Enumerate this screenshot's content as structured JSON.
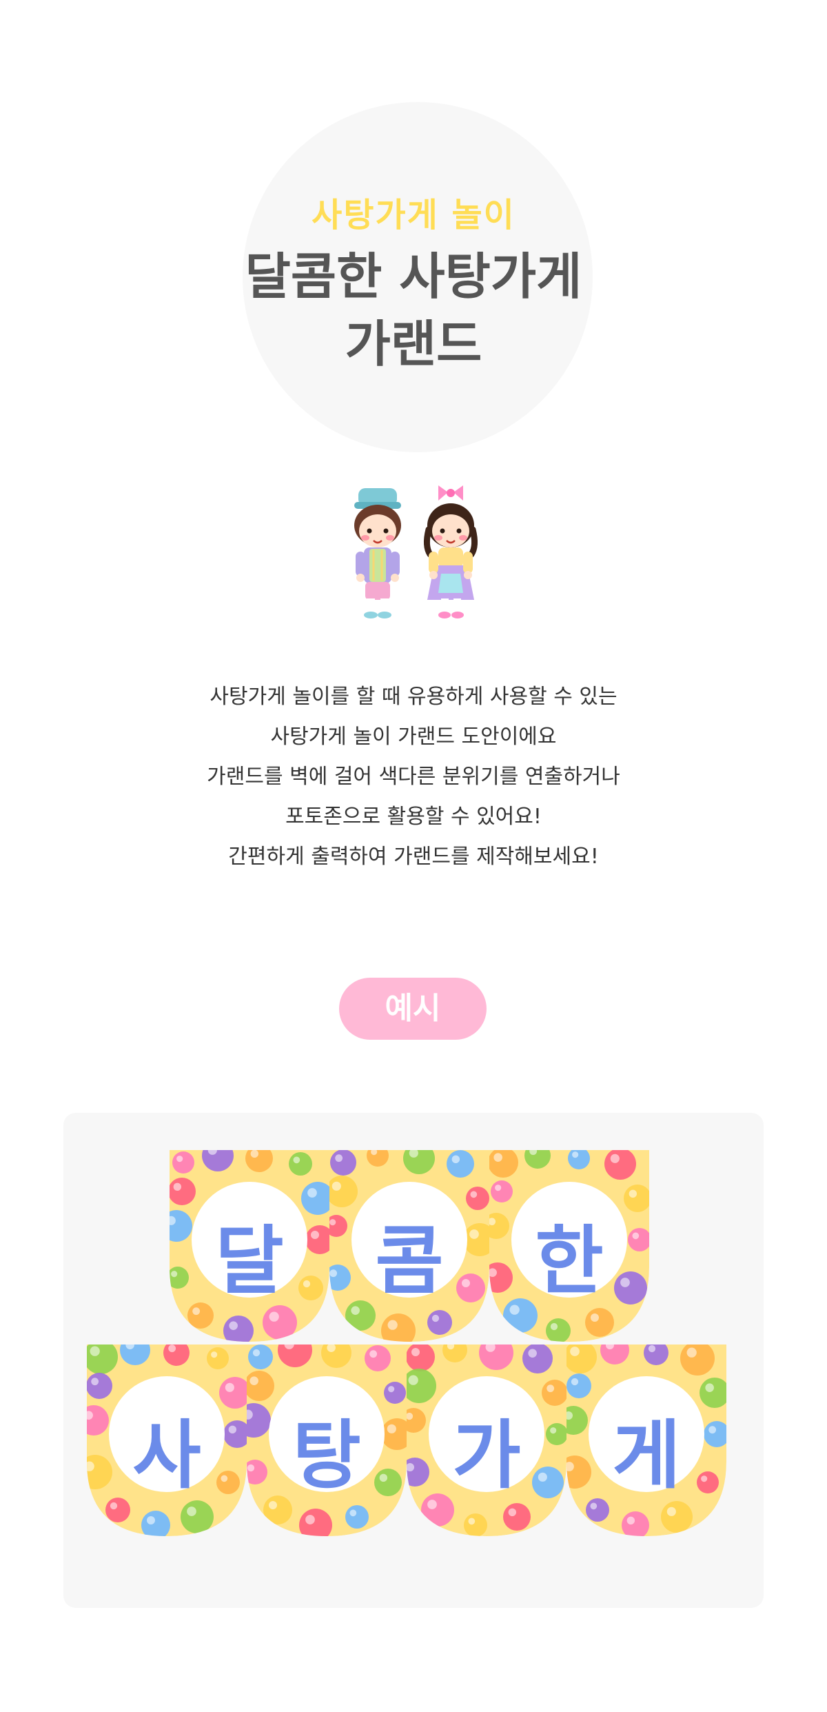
{
  "header": {
    "subtitle": "사탕가게 놀이",
    "title_line1": "달콤한 사탕가게",
    "title_line2": "가랜드"
  },
  "illustration": {
    "name": "kids-characters"
  },
  "description": {
    "lines": [
      "사탕가게 놀이를 할 때 유용하게 사용할 수 있는",
      "사탕가게 놀이 가랜드 도안이에요",
      "가랜드를 벽에 걸어 색다른 분위기를 연출하거나",
      "포토존으로 활용할 수 있어요!",
      "간편하게 출력하여 가랜드를 제작해보세요!"
    ]
  },
  "example": {
    "label": "예시",
    "row1": [
      "달",
      "콤",
      "한"
    ],
    "row2": [
      "사",
      "탕",
      "가",
      "게"
    ]
  },
  "colors": {
    "subtitle": "#ffdd55",
    "title": "#555555",
    "pill": "#ffb9d6",
    "letter": "#6b8be9",
    "flag_bg": "#ffe38a"
  }
}
